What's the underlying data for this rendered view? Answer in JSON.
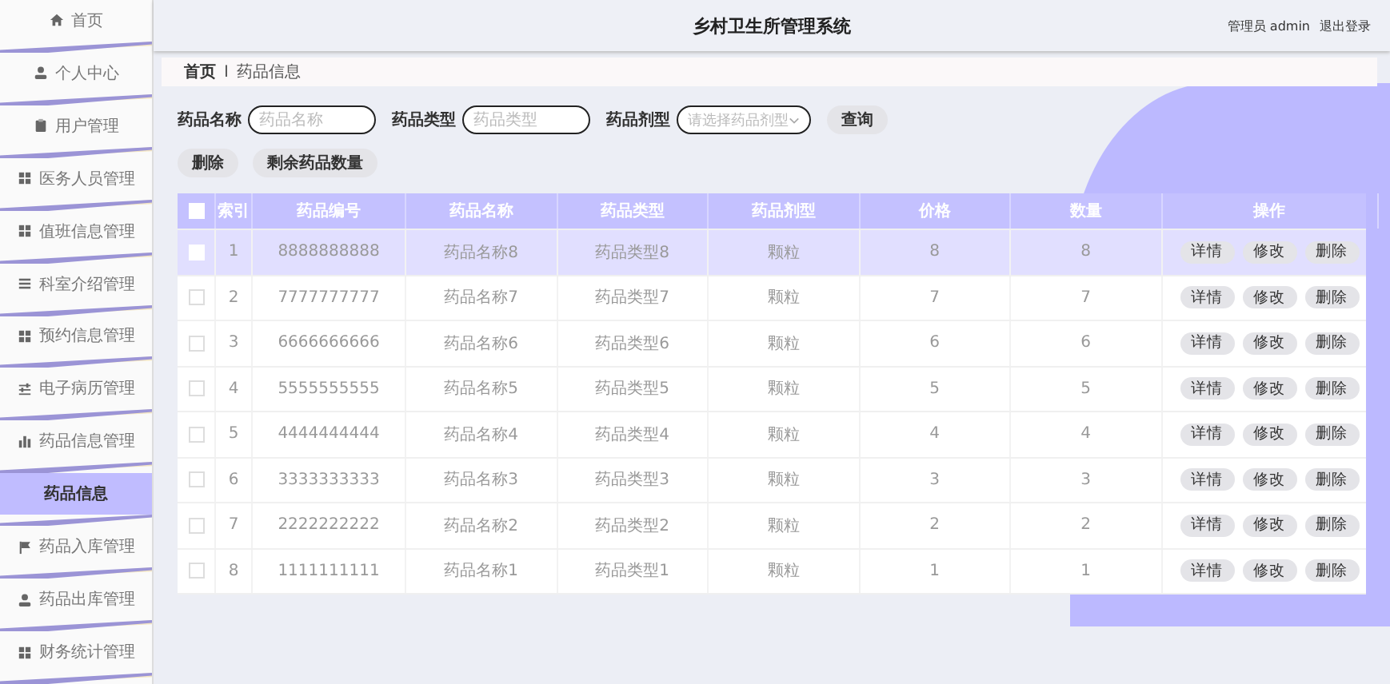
{
  "sidebar": {
    "items": [
      {
        "label": "首页",
        "selected": false
      },
      {
        "label": "个人中心",
        "selected": false
      },
      {
        "label": "用户管理",
        "selected": false
      },
      {
        "label": "医务人员管理",
        "selected": false
      },
      {
        "label": "值班信息管理",
        "selected": false
      },
      {
        "label": "科室介绍管理",
        "selected": false
      },
      {
        "label": "预约信息管理",
        "selected": false
      },
      {
        "label": "电子病历管理",
        "selected": false
      },
      {
        "label": "药品信息管理",
        "selected": false,
        "expanded": true,
        "children": [
          {
            "label": "药品信息",
            "selected": true
          }
        ]
      },
      {
        "label": "药品入库管理",
        "selected": false
      },
      {
        "label": "药品出库管理",
        "selected": false
      },
      {
        "label": "财务统计管理",
        "selected": false
      }
    ]
  },
  "header": {
    "title": "乡村卫生所管理系统",
    "user": "管理员 admin",
    "logout": "退出登录"
  },
  "breadcrumb": {
    "items": [
      "首页",
      "药品信息"
    ],
    "separator": "I"
  },
  "search": {
    "fields": [
      {
        "label": "药品名称",
        "placeholder": "药品名称",
        "kind": "input"
      },
      {
        "label": "药品类型",
        "placeholder": "药品类型",
        "kind": "input"
      },
      {
        "label": "药品剂型",
        "placeholder": "请选择药品剂型",
        "kind": "select"
      }
    ],
    "button": "查询"
  },
  "actions": [
    "删除",
    "剩余药品数量"
  ],
  "table": {
    "all_checked": false,
    "columns": [
      "索引",
      "药品编号",
      "药品名称",
      "药品类型",
      "药品剂型",
      "价格",
      "数量",
      "操作"
    ],
    "rows": [
      {
        "selected": true,
        "checked": false,
        "cells": [
          "1",
          "8888888888",
          "药品名称8",
          "药品类型8",
          "颗粒",
          "8",
          "8"
        ],
        "actions": [
          "详情",
          "修改",
          "删除"
        ]
      },
      {
        "selected": false,
        "checked": false,
        "cells": [
          "2",
          "7777777777",
          "药品名称7",
          "药品类型7",
          "颗粒",
          "7",
          "7"
        ],
        "actions": [
          "详情",
          "修改",
          "删除"
        ]
      },
      {
        "selected": false,
        "checked": false,
        "cells": [
          "3",
          "6666666666",
          "药品名称6",
          "药品类型6",
          "颗粒",
          "6",
          "6"
        ],
        "actions": [
          "详情",
          "修改",
          "删除"
        ]
      },
      {
        "selected": false,
        "checked": false,
        "cells": [
          "4",
          "5555555555",
          "药品名称5",
          "药品类型5",
          "颗粒",
          "5",
          "5"
        ],
        "actions": [
          "详情",
          "修改",
          "删除"
        ]
      },
      {
        "selected": false,
        "checked": false,
        "cells": [
          "5",
          "4444444444",
          "药品名称4",
          "药品类型4",
          "颗粒",
          "4",
          "4"
        ],
        "actions": [
          "详情",
          "修改",
          "删除"
        ]
      },
      {
        "selected": false,
        "checked": false,
        "cells": [
          "6",
          "3333333333",
          "药品名称3",
          "药品类型3",
          "颗粒",
          "3",
          "3"
        ],
        "actions": [
          "详情",
          "修改",
          "删除"
        ]
      },
      {
        "selected": false,
        "checked": false,
        "cells": [
          "7",
          "2222222222",
          "药品名称2",
          "药品类型2",
          "颗粒",
          "2",
          "2"
        ],
        "actions": [
          "详情",
          "修改",
          "删除"
        ]
      },
      {
        "selected": false,
        "checked": false,
        "cells": [
          "8",
          "1111111111",
          "药品名称1",
          "药品类型1",
          "颗粒",
          "1",
          "1"
        ],
        "actions": [
          "详情",
          "修改",
          "删除"
        ]
      }
    ]
  }
}
